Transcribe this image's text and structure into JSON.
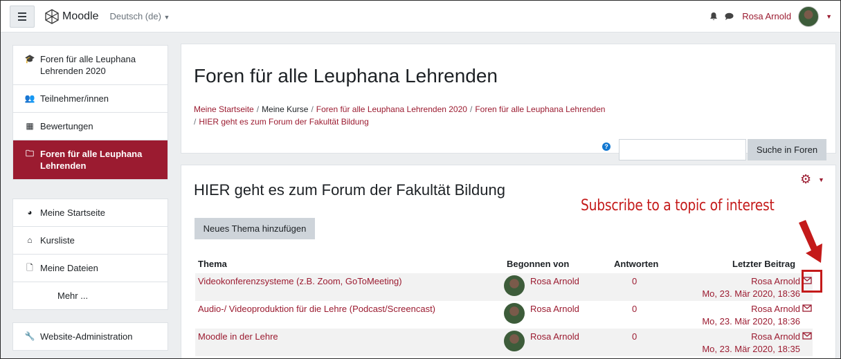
{
  "navbar": {
    "logo_text": "Moodle",
    "language": "Deutsch (de)",
    "user_name": "Rosa Arnold"
  },
  "sidebar": {
    "group1": [
      {
        "label": "Foren für alle Leuphana Lehrenden 2020",
        "icon": "graduation-cap-icon",
        "active": false
      },
      {
        "label": "Teilnehmer/innen",
        "icon": "users-icon",
        "active": false
      },
      {
        "label": "Bewertungen",
        "icon": "table-icon",
        "active": false
      },
      {
        "label": "Foren für alle Leuphana Lehrenden",
        "icon": "folder-icon",
        "active": true
      }
    ],
    "group2": [
      {
        "label": "Meine Startseite",
        "icon": "dashboard-icon"
      },
      {
        "label": "Kursliste",
        "icon": "home-icon"
      },
      {
        "label": "Meine Dateien",
        "icon": "file-icon"
      },
      {
        "label": "Mehr ...",
        "icon": ""
      }
    ],
    "group3": [
      {
        "label": "Website-Administration",
        "icon": "wrench-icon"
      }
    ]
  },
  "header": {
    "title": "Foren für alle Leuphana Lehrenden",
    "breadcrumb": [
      {
        "label": "Meine Startseite",
        "link": true
      },
      {
        "label": "Meine Kurse",
        "link": false
      },
      {
        "label": "Foren für alle Leuphana Lehrenden 2020",
        "link": true
      },
      {
        "label": "Foren für alle Leuphana Lehrenden",
        "link": true
      },
      {
        "label": "HIER geht es zum Forum der Fakultät Bildung",
        "link": true
      }
    ],
    "search_button": "Suche in Foren"
  },
  "forum": {
    "title": "HIER geht es zum Forum der Fakultät Bildung",
    "new_topic_button": "Neues Thema hinzufügen",
    "columns": [
      "Thema",
      "Begonnen von",
      "Antworten",
      "Letzter Beitrag"
    ],
    "rows": [
      {
        "topic": "Videokonferenzsysteme (z.B. Zoom, GoToMeeting)",
        "author": "Rosa Arnold",
        "replies": "0",
        "last_user": "Rosa Arnold",
        "last_date": "Mo, 23. Mär 2020, 18:36"
      },
      {
        "topic": "Audio-/ Videoproduktion für die Lehre (Podcast/Screencast)",
        "author": "Rosa Arnold",
        "replies": "0",
        "last_user": "Rosa Arnold",
        "last_date": "Mo, 23. Mär 2020, 18:36"
      },
      {
        "topic": "Moodle in der Lehre",
        "author": "Rosa Arnold",
        "replies": "0",
        "last_user": "Rosa Arnold",
        "last_date": "Mo, 23. Mär 2020, 18:35"
      }
    ]
  },
  "annotation": {
    "text": "Subscribe to a topic of interest",
    "color": "#c41a1a"
  },
  "colors": {
    "brand": "#9b1b30",
    "background": "#eceef0"
  }
}
